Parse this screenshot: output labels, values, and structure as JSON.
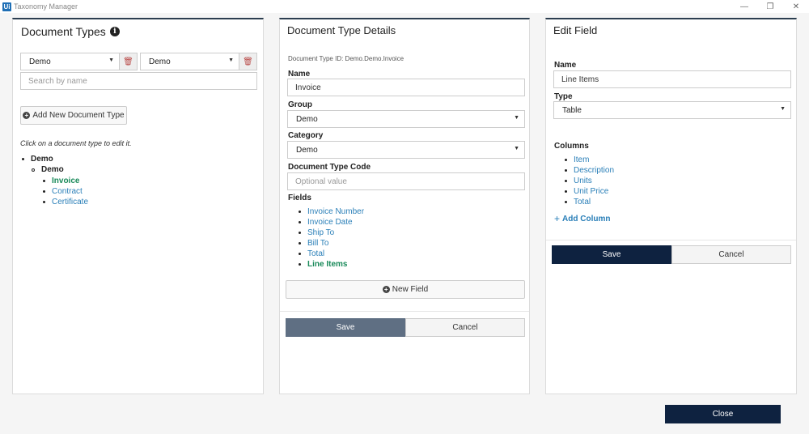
{
  "window": {
    "icon_text": "Ui",
    "title": "Taxonomy Manager"
  },
  "document_types": {
    "heading": "Document Types",
    "group_select": "Demo",
    "category_select": "Demo",
    "search_placeholder": "Search by name",
    "add_button": "Add New Document Type",
    "hint": "Click on a document type to edit it.",
    "tree": {
      "group": "Demo",
      "category": "Demo",
      "types": [
        "Invoice",
        "Contract",
        "Certificate"
      ],
      "active_type": "Invoice"
    }
  },
  "document_type_details": {
    "heading": "Document Type Details",
    "id_text": "Document Type ID: Demo.Demo.Invoice",
    "name_label": "Name",
    "name_value": "Invoice",
    "group_label": "Group",
    "group_value": "Demo",
    "category_label": "Category",
    "category_value": "Demo",
    "code_label": "Document Type Code",
    "code_placeholder": "Optional value",
    "fields_label": "Fields",
    "fields": [
      "Invoice Number",
      "Invoice Date",
      "Ship To",
      "Bill To",
      "Total",
      "Line Items"
    ],
    "active_field": "Line Items",
    "new_field_button": "New Field",
    "save_button": "Save",
    "cancel_button": "Cancel"
  },
  "edit_field": {
    "heading": "Edit Field",
    "name_label": "Name",
    "name_value": "Line Items",
    "type_label": "Type",
    "type_value": "Table",
    "columns_label": "Columns",
    "columns": [
      "Item",
      "Description",
      "Units",
      "Unit Price",
      "Total"
    ],
    "add_column": "Add Column",
    "save_button": "Save",
    "cancel_button": "Cancel"
  },
  "close_button": "Close",
  "colors": {
    "accent_navy": "#0e2240",
    "link": "#2a7fb8",
    "active": "#1a8a5a",
    "save_grey": "#5f6f83"
  }
}
